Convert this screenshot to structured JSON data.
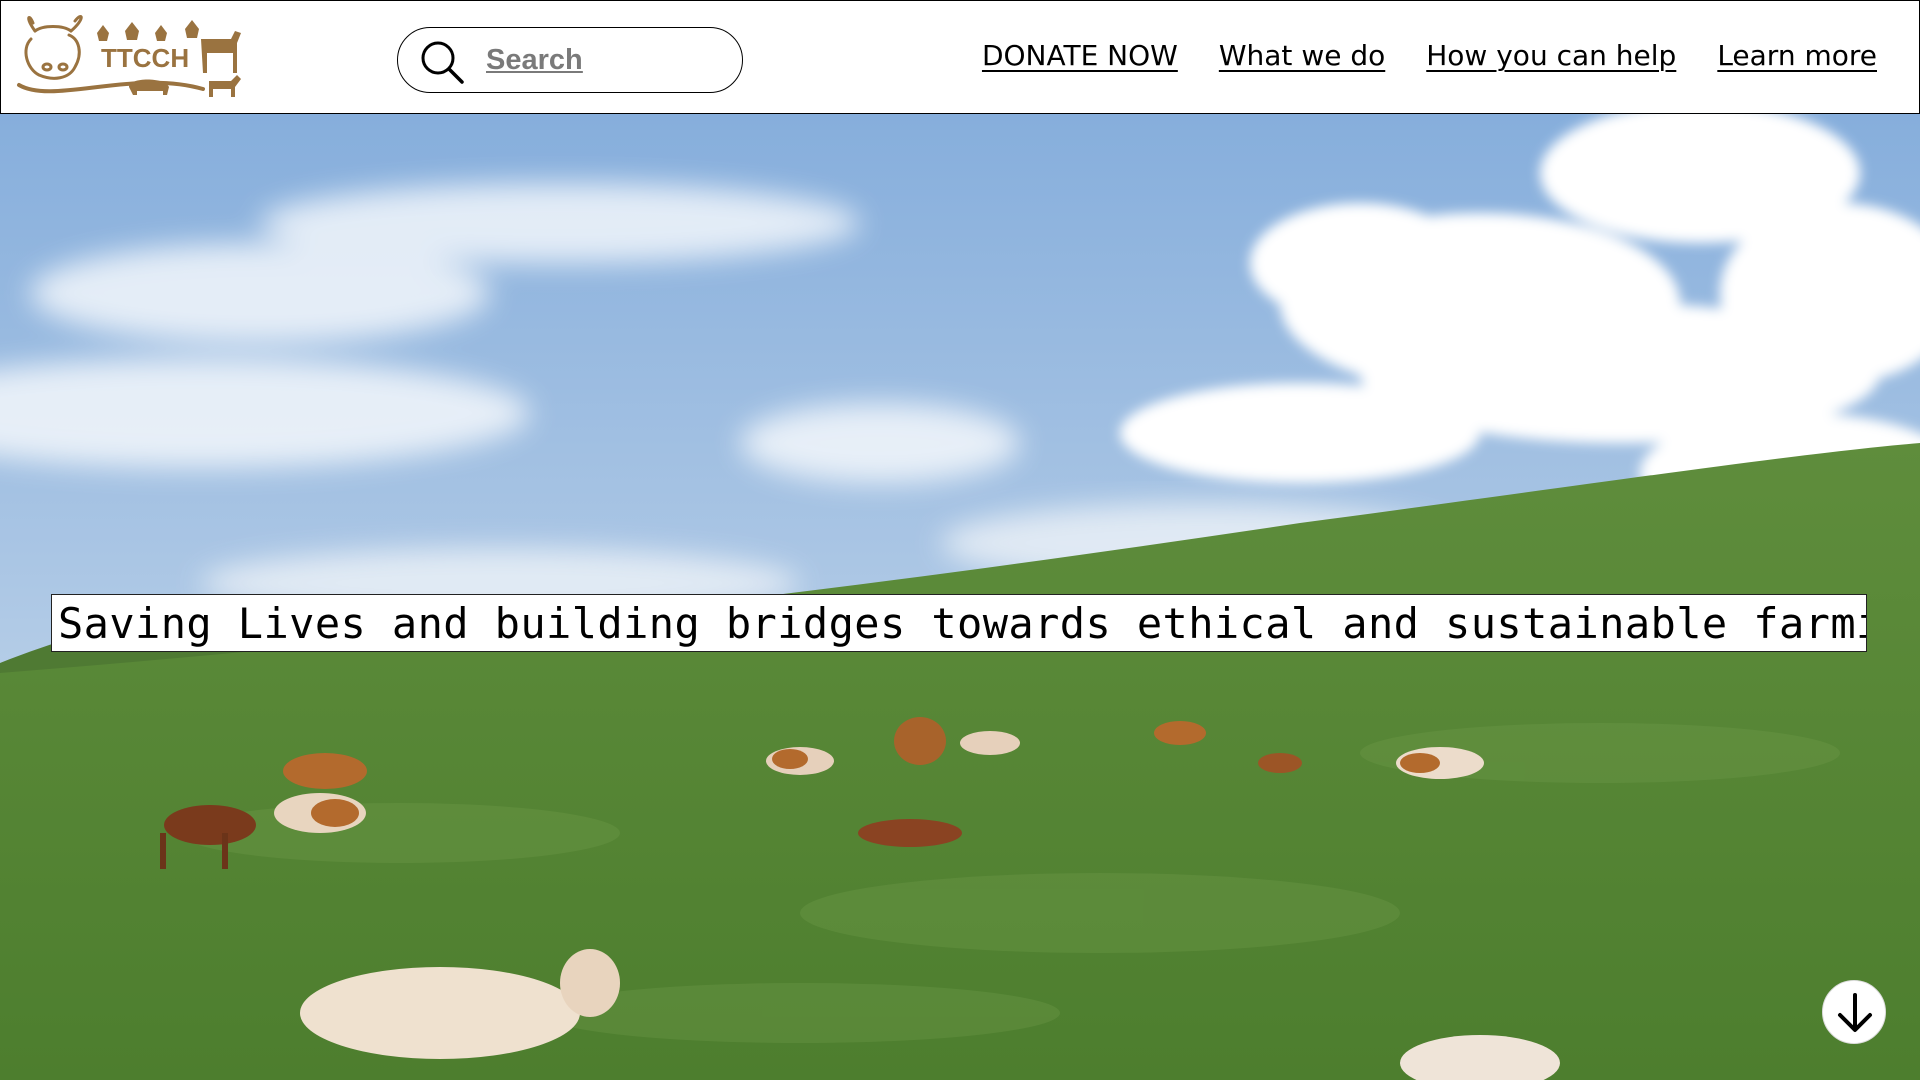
{
  "brand": {
    "logo_text": "TTCCH",
    "color": "#9a7340"
  },
  "search": {
    "placeholder": "Search",
    "icon": "search-icon"
  },
  "nav": {
    "items": [
      {
        "label": "DONATE NOW"
      },
      {
        "label": "What we do"
      },
      {
        "label": "How you can help"
      },
      {
        "label": "Learn more"
      }
    ]
  },
  "hero": {
    "tagline": "Saving Lives and building bridges towards ethical and sustainable farming.",
    "scroll_icon": "arrow-down-icon"
  }
}
